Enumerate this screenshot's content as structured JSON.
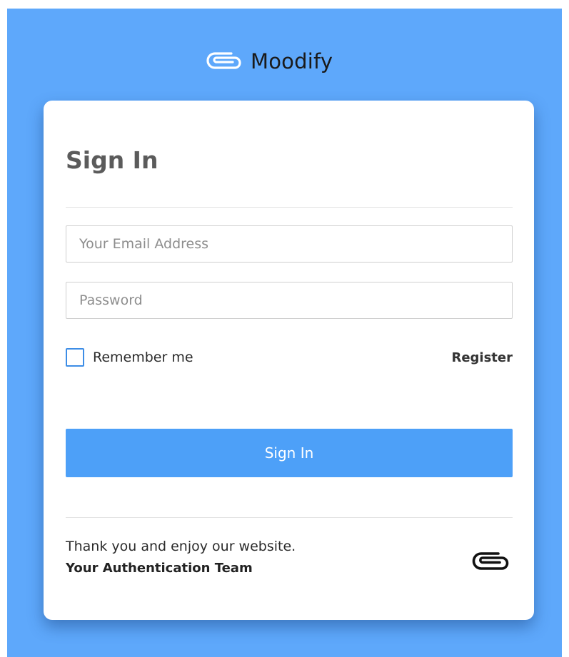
{
  "brand": {
    "name": "Moodify",
    "icon": "paperclip-icon"
  },
  "card": {
    "title": "Sign In",
    "email_placeholder": "Your Email Address",
    "password_placeholder": "Password",
    "email_value": "",
    "password_value": "",
    "remember_label": "Remember me",
    "remember_checked": false,
    "register_label": "Register",
    "signin_button_label": "Sign In",
    "footer_message": "Thank you and enjoy our website.",
    "footer_signature": "Your Authentication Team",
    "footer_icon": "paperclip-icon"
  },
  "colors": {
    "background": "#5ea8fb",
    "button": "#4da0f8",
    "checkbox_border": "#3d8de6",
    "card": "#ffffff"
  }
}
